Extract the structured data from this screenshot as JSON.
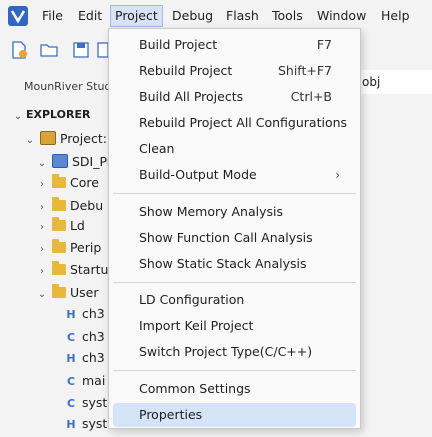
{
  "menubar": {
    "items": [
      "File",
      "Edit",
      "Project",
      "Debug",
      "Flash",
      "Tools",
      "Window",
      "Help"
    ],
    "active": "Project"
  },
  "toolbar": {
    "path_suffix": "obj"
  },
  "perspective": "MounRiver Studi",
  "explorer": {
    "header": "EXPLORER",
    "project": "Project:",
    "root": "SDI_Pr",
    "folders": [
      "Core",
      "Debu",
      "Ld",
      "Perip",
      "Startu",
      "User"
    ],
    "files": [
      {
        "icon": "H",
        "name": "ch3"
      },
      {
        "icon": "C",
        "name": "ch3"
      },
      {
        "icon": "H",
        "name": "ch3"
      },
      {
        "icon": "C",
        "name": "mai"
      },
      {
        "icon": "C",
        "name": "syst"
      },
      {
        "icon": "H",
        "name": "syst"
      }
    ]
  },
  "project_menu": {
    "groups": [
      [
        {
          "label": "Build Project",
          "shortcut": "F7"
        },
        {
          "label": "Rebuild Project",
          "shortcut": "Shift+F7"
        },
        {
          "label": "Build All Projects",
          "shortcut": "Ctrl+B"
        },
        {
          "label": "Rebuild Project All Configurations",
          "shortcut": ""
        },
        {
          "label": "Clean",
          "shortcut": ""
        },
        {
          "label": "Build-Output Mode",
          "shortcut": "",
          "submenu": true
        }
      ],
      [
        {
          "label": "Show Memory Analysis",
          "shortcut": ""
        },
        {
          "label": "Show Function Call Analysis",
          "shortcut": ""
        },
        {
          "label": "Show Static Stack Analysis",
          "shortcut": ""
        }
      ],
      [
        {
          "label": "LD Configuration",
          "shortcut": ""
        },
        {
          "label": "Import Keil Project",
          "shortcut": ""
        },
        {
          "label": "Switch Project Type(C/C++)",
          "shortcut": ""
        }
      ],
      [
        {
          "label": "Common Settings",
          "shortcut": ""
        },
        {
          "label": "Properties",
          "shortcut": "",
          "highlighted": true
        }
      ]
    ]
  },
  "colors": {
    "highlight": "#d5e3f6",
    "folder": "#e8b83a",
    "file_letter": "#3b6fc9"
  }
}
